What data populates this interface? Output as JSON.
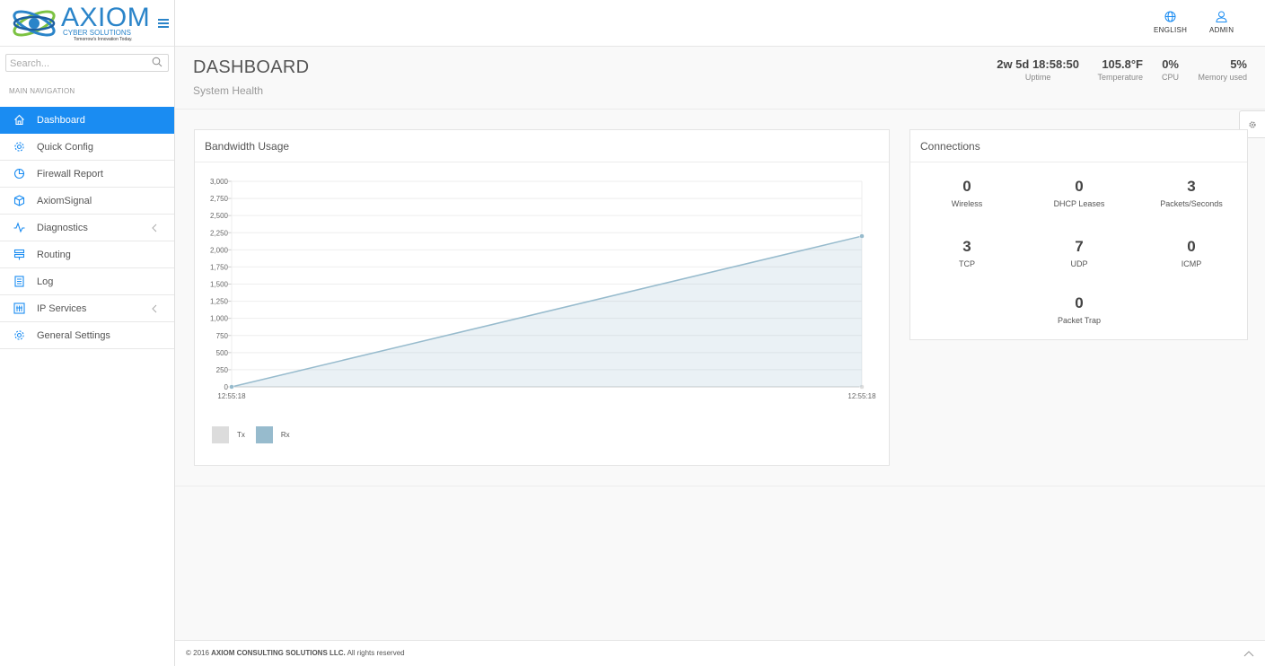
{
  "brand": {
    "name": "AXIOM",
    "sub": "CYBER SOLUTIONS",
    "tagline": "Tomorrow's Innovation Today.",
    "accent": "#1a8cf2"
  },
  "search": {
    "placeholder": "Search..."
  },
  "sidebar": {
    "header": "MAIN NAVIGATION",
    "items": [
      {
        "label": "Dashboard",
        "icon": "home-icon",
        "active": true
      },
      {
        "label": "Quick Config",
        "icon": "gear-icon"
      },
      {
        "label": "Firewall Report",
        "icon": "pie-chart-icon"
      },
      {
        "label": "AxiomSignal",
        "icon": "cube-icon"
      },
      {
        "label": "Diagnostics",
        "icon": "pulse-icon",
        "expandable": true
      },
      {
        "label": "Routing",
        "icon": "routing-icon"
      },
      {
        "label": "Log",
        "icon": "log-icon"
      },
      {
        "label": "IP Services",
        "icon": "ip-services-icon",
        "expandable": true
      },
      {
        "label": "General Settings",
        "icon": "settings-icon"
      }
    ]
  },
  "topbar": {
    "language": "ENGLISH",
    "user": "ADMIN"
  },
  "header": {
    "title": "DASHBOARD",
    "subtitle": "System Health",
    "stats": {
      "uptime": {
        "value": "2w 5d 18:58:50",
        "label": "Uptime"
      },
      "temperature": {
        "value": "105.8°F",
        "label": "Temperature"
      },
      "cpu": {
        "value": "0%",
        "label": "CPU"
      },
      "memory": {
        "value": "5%",
        "label": "Memory used"
      }
    }
  },
  "bandwidth": {
    "title": "Bandwidth Usage",
    "legend": {
      "tx": "Tx",
      "rx": "Rx",
      "tx_color": "#dcdcdc",
      "rx_color": "#97bbcd"
    }
  },
  "chart_data": {
    "type": "area",
    "x": [
      "12:55:18",
      "12:55:18"
    ],
    "series": [
      {
        "name": "Tx",
        "values": [
          0,
          0
        ]
      },
      {
        "name": "Rx",
        "values": [
          0,
          2200
        ]
      }
    ],
    "yticks": [
      "0",
      "250",
      "500",
      "750",
      "1,000",
      "1,250",
      "1,500",
      "1,750",
      "2,000",
      "2,250",
      "2,500",
      "2,750",
      "3,000"
    ],
    "ylim": [
      0,
      3000
    ],
    "grid": true,
    "legend": "bottom-left"
  },
  "connections": {
    "title": "Connections",
    "items": [
      {
        "value": "0",
        "label": "Wireless"
      },
      {
        "value": "0",
        "label": "DHCP Leases"
      },
      {
        "value": "3",
        "label": "Packets/Seconds"
      },
      {
        "value": "3",
        "label": "TCP"
      },
      {
        "value": "7",
        "label": "UDP"
      },
      {
        "value": "0",
        "label": "ICMP"
      },
      {
        "value": "0",
        "label": "Packet Trap"
      }
    ]
  },
  "footer": {
    "copyright": "© 2016",
    "company": "AXIOM CONSULTING SOLUTIONS LLC.",
    "rights": "All rights reserved"
  }
}
